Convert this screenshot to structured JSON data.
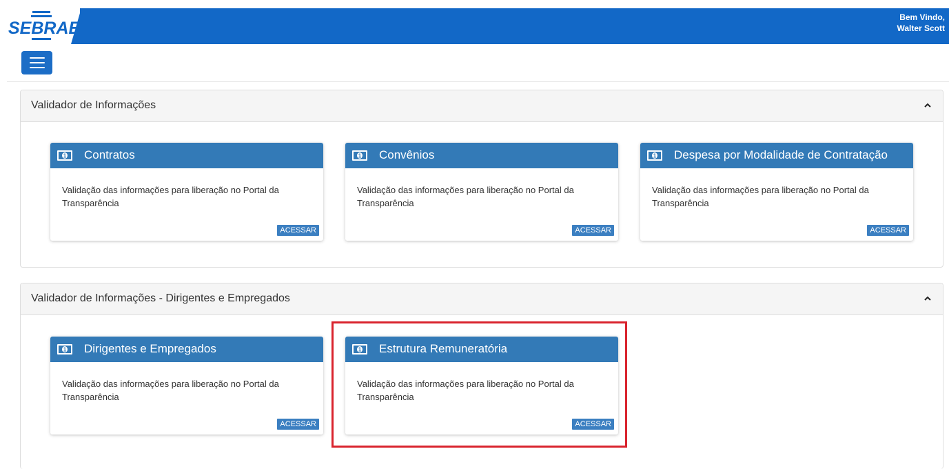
{
  "header": {
    "logo_text": "SEBRAE",
    "welcome_line1": "Bem Vindo,",
    "welcome_line2": "Walter Scott"
  },
  "panels": [
    {
      "title": "Validador de Informações",
      "cards": [
        {
          "title": "Contratos",
          "text": "Validação das informações para liberação no Portal da Transparência",
          "button": "ACESSAR"
        },
        {
          "title": "Convênios",
          "text": "Validação das informações para liberação no Portal da Transparência",
          "button": "ACESSAR"
        },
        {
          "title": "Despesa por Modalidade de Contratação",
          "text": "Validação das informações para liberação no Portal da Transparência",
          "button": "ACESSAR"
        }
      ]
    },
    {
      "title": "Validador de Informações - Dirigentes e Empregados",
      "cards": [
        {
          "title": "Dirigentes e Empregados",
          "text": "Validação das informações para liberação no Portal da Transparência",
          "button": "ACESSAR"
        },
        {
          "title": "Estrutura Remuneratória",
          "text": "Validação das informações para liberação no Portal da Transparência",
          "button": "ACESSAR"
        }
      ]
    }
  ],
  "colors": {
    "header_blue": "#1268c7",
    "card_header": "#337ab7",
    "highlight": "#d9232d"
  },
  "icons": {
    "card": "money-bill-icon",
    "collapse": "chevron-up-icon",
    "menu": "hamburger-icon"
  }
}
